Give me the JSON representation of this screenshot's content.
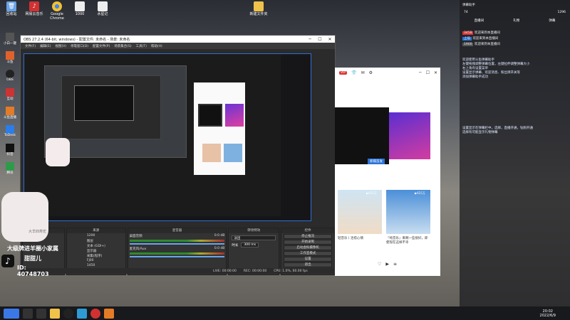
{
  "desktop_icons": [
    {
      "label": "回收站",
      "color": "#6aa2e8"
    },
    {
      "label": "网易云音乐",
      "color": "#d23131"
    },
    {
      "label": "Google Chrome",
      "color": "#f2c12e"
    },
    {
      "label": "1000",
      "color": "#eeeeee"
    },
    {
      "label": "水星记",
      "color": "#eeeeee"
    },
    {
      "label": "新建文件夹",
      "color": "#f0c24a"
    }
  ],
  "left_icons": [
    "小白一键",
    "斗鱼",
    "OBS",
    "互动",
    "斗鱼直播",
    "ToDesk",
    "抖音",
    "腾讯"
  ],
  "obs": {
    "title": "OBS 27.2.4 (64-bit, windows) - 配置文件: 未命名 - 场景: 未命名",
    "menu": [
      "文件(F)",
      "编辑(E)",
      "视图(V)",
      "停靠窗口(D)",
      "配置文件(P)",
      "场景集合(S)",
      "工具(T)",
      "帮助(H)"
    ],
    "docks": {
      "scenes": "场景",
      "sources": "来源",
      "mixer": "混音器",
      "transitions": "转场特效",
      "controls": "控件"
    },
    "sources": [
      "1200",
      "图层",
      "文本 (GDI+)",
      "显示器",
      "采集(程序)",
      "FJ00",
      "1450"
    ],
    "mixer": [
      {
        "name": "桌面音频",
        "db": "0.0 dB"
      },
      {
        "name": "麦克风/Aux",
        "db": "0.0 dB"
      }
    ],
    "transition": {
      "type": "淡出",
      "duration_label": "时长",
      "duration": "300 ms"
    },
    "controls": [
      "停止推流",
      "开始录制",
      "启动虚拟摄像机",
      "工作室模式",
      "设置",
      "退出"
    ],
    "status": {
      "live": "LIVE: 00:00:00",
      "rec": "REC: 00:00:00",
      "cpu": "CPU: 1.0%, 60.00 fps"
    }
  },
  "overlay": {
    "line1": "大级牌进羊圈小家属",
    "line2": "甜甜儿",
    "id": "ID: 40748703",
    "watermark": "大羊四寿宏"
  },
  "browser": {
    "tag1": "VIP",
    "cards": [
      {
        "caption": "轻音乐丨治愈心情",
        "badge": "▶615万"
      },
      {
        "caption": "『纯音乐』来啊一些很好，即使现在这样不幸",
        "badge": "▶615万"
      }
    ],
    "tag_new": "新碟首发"
  },
  "chat": {
    "header": "弹幕助手",
    "stats": {
      "viewers": "74",
      "gifts": "1296"
    },
    "tabs": [
      "直播间",
      "礼物",
      "弹幕"
    ],
    "messages": [
      {
        "user": "3458",
        "text": "欢迎来到本直播间"
      },
      {
        "user": "上号",
        "text": "欢迎来到本直播间"
      },
      {
        "user": "1900",
        "text": "欢迎来到本直播间"
      }
    ],
    "notice1": "欢迎使用斗鱼弹幕助手\n左键拖拽调整弹幕位置，左键拉伸调整弹幕大小\n右上角有设置菜单\n设置显示弹幕、欢迎消息、粉丝牌开关等\n添加弹幕助手成功",
    "notice2": "设置显示在弹幕栏中，选择，直播开通，钻粉开通\n选择有可能显示礼物弹幕"
  },
  "taskbar": {
    "time": "20:02",
    "date": "2022/6/9"
  }
}
